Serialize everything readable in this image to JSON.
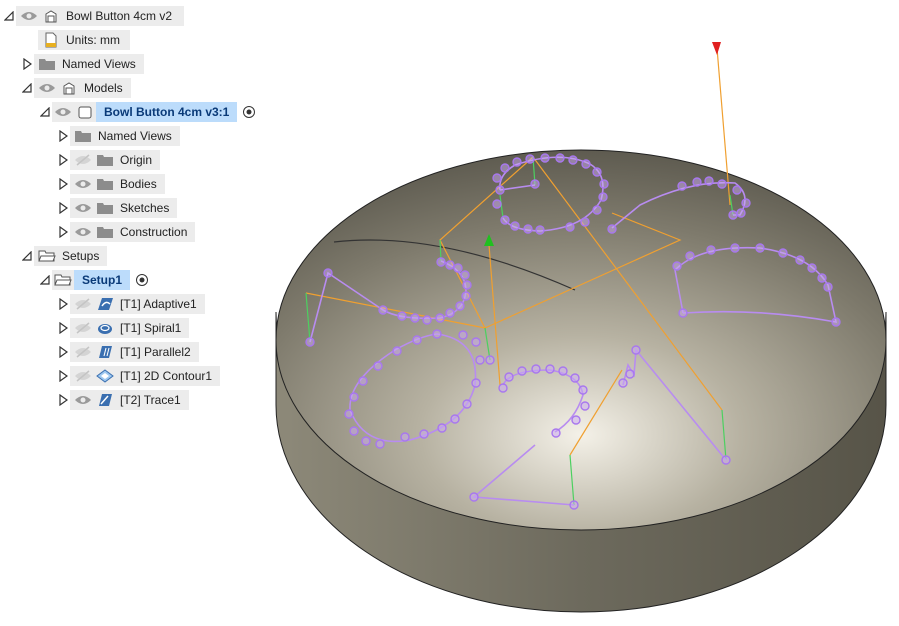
{
  "browser": {
    "root": {
      "label": "Bowl Button 4cm v2"
    },
    "units": {
      "label": "Units: mm"
    },
    "named_views": {
      "label": "Named Views"
    },
    "models": {
      "label": "Models"
    },
    "component": {
      "label": "Bowl Button 4cm v3:1"
    },
    "component_children": [
      {
        "label": "Named Views"
      },
      {
        "label": "Origin"
      },
      {
        "label": "Bodies"
      },
      {
        "label": "Sketches"
      },
      {
        "label": "Construction"
      }
    ],
    "setups": {
      "label": "Setups"
    },
    "setup1": {
      "label": "Setup1"
    },
    "operations": [
      {
        "label": "[T1] Adaptive1",
        "icon": "adaptive-icon"
      },
      {
        "label": "[T1] Spiral1",
        "icon": "spiral-icon"
      },
      {
        "label": "[T1] Parallel2",
        "icon": "parallel-icon"
      },
      {
        "label": "[T1] 2D Contour1",
        "icon": "contour-icon"
      },
      {
        "label": "[T2] Trace1",
        "icon": "trace-icon"
      }
    ]
  },
  "viewport": {
    "body_color": "#8a8576",
    "toolpath_color": "#b88cf0",
    "rapid_color": "#f0a030",
    "plunge_color": "#4cd060",
    "start_marker_color": "#e02020",
    "current_marker_color": "#20c020"
  }
}
